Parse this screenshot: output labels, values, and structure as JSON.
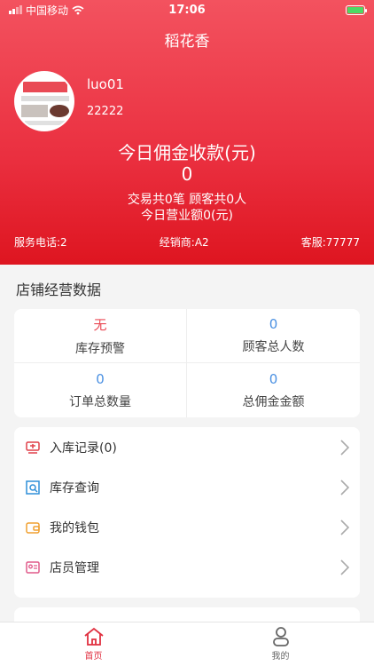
{
  "status": {
    "carrier": "中国移动",
    "time": "17:06"
  },
  "nav": {
    "title": "稻花香"
  },
  "profile": {
    "username": "luo01",
    "user_id": "22222"
  },
  "summary": {
    "title": "今日佣金收款(元)",
    "value": "0",
    "line1": "交易共0笔  顾客共0人",
    "line2": "今日营业额0(元)"
  },
  "info": {
    "service_phone": "服务电话:2",
    "dealer": "经销商:A2",
    "customer_service": "客服:77777"
  },
  "section": {
    "title": "店铺经营数据"
  },
  "stats": [
    {
      "value": "无",
      "label": "库存预警"
    },
    {
      "value": "0",
      "label": "顾客总人数"
    },
    {
      "value": "0",
      "label": "订单总数量"
    },
    {
      "value": "0",
      "label": "总佣金金额"
    }
  ],
  "menu": [
    {
      "label": "入库记录(0)",
      "icon": "inbound-record-icon",
      "color": "#e0404a"
    },
    {
      "label": "库存查询",
      "icon": "inventory-search-icon",
      "color": "#2f8fd8"
    },
    {
      "label": "我的钱包",
      "icon": "wallet-icon",
      "color": "#f0a030"
    },
    {
      "label": "店员管理",
      "icon": "staff-card-icon",
      "color": "#e05a8a"
    }
  ],
  "tabs": [
    {
      "label": "首页",
      "icon": "home-icon",
      "active": true
    },
    {
      "label": "我的",
      "icon": "user-icon",
      "active": false
    }
  ],
  "colors": {
    "header": "#ea2f3f",
    "accent": "#e03040",
    "stat_value": "#4a90e2"
  }
}
